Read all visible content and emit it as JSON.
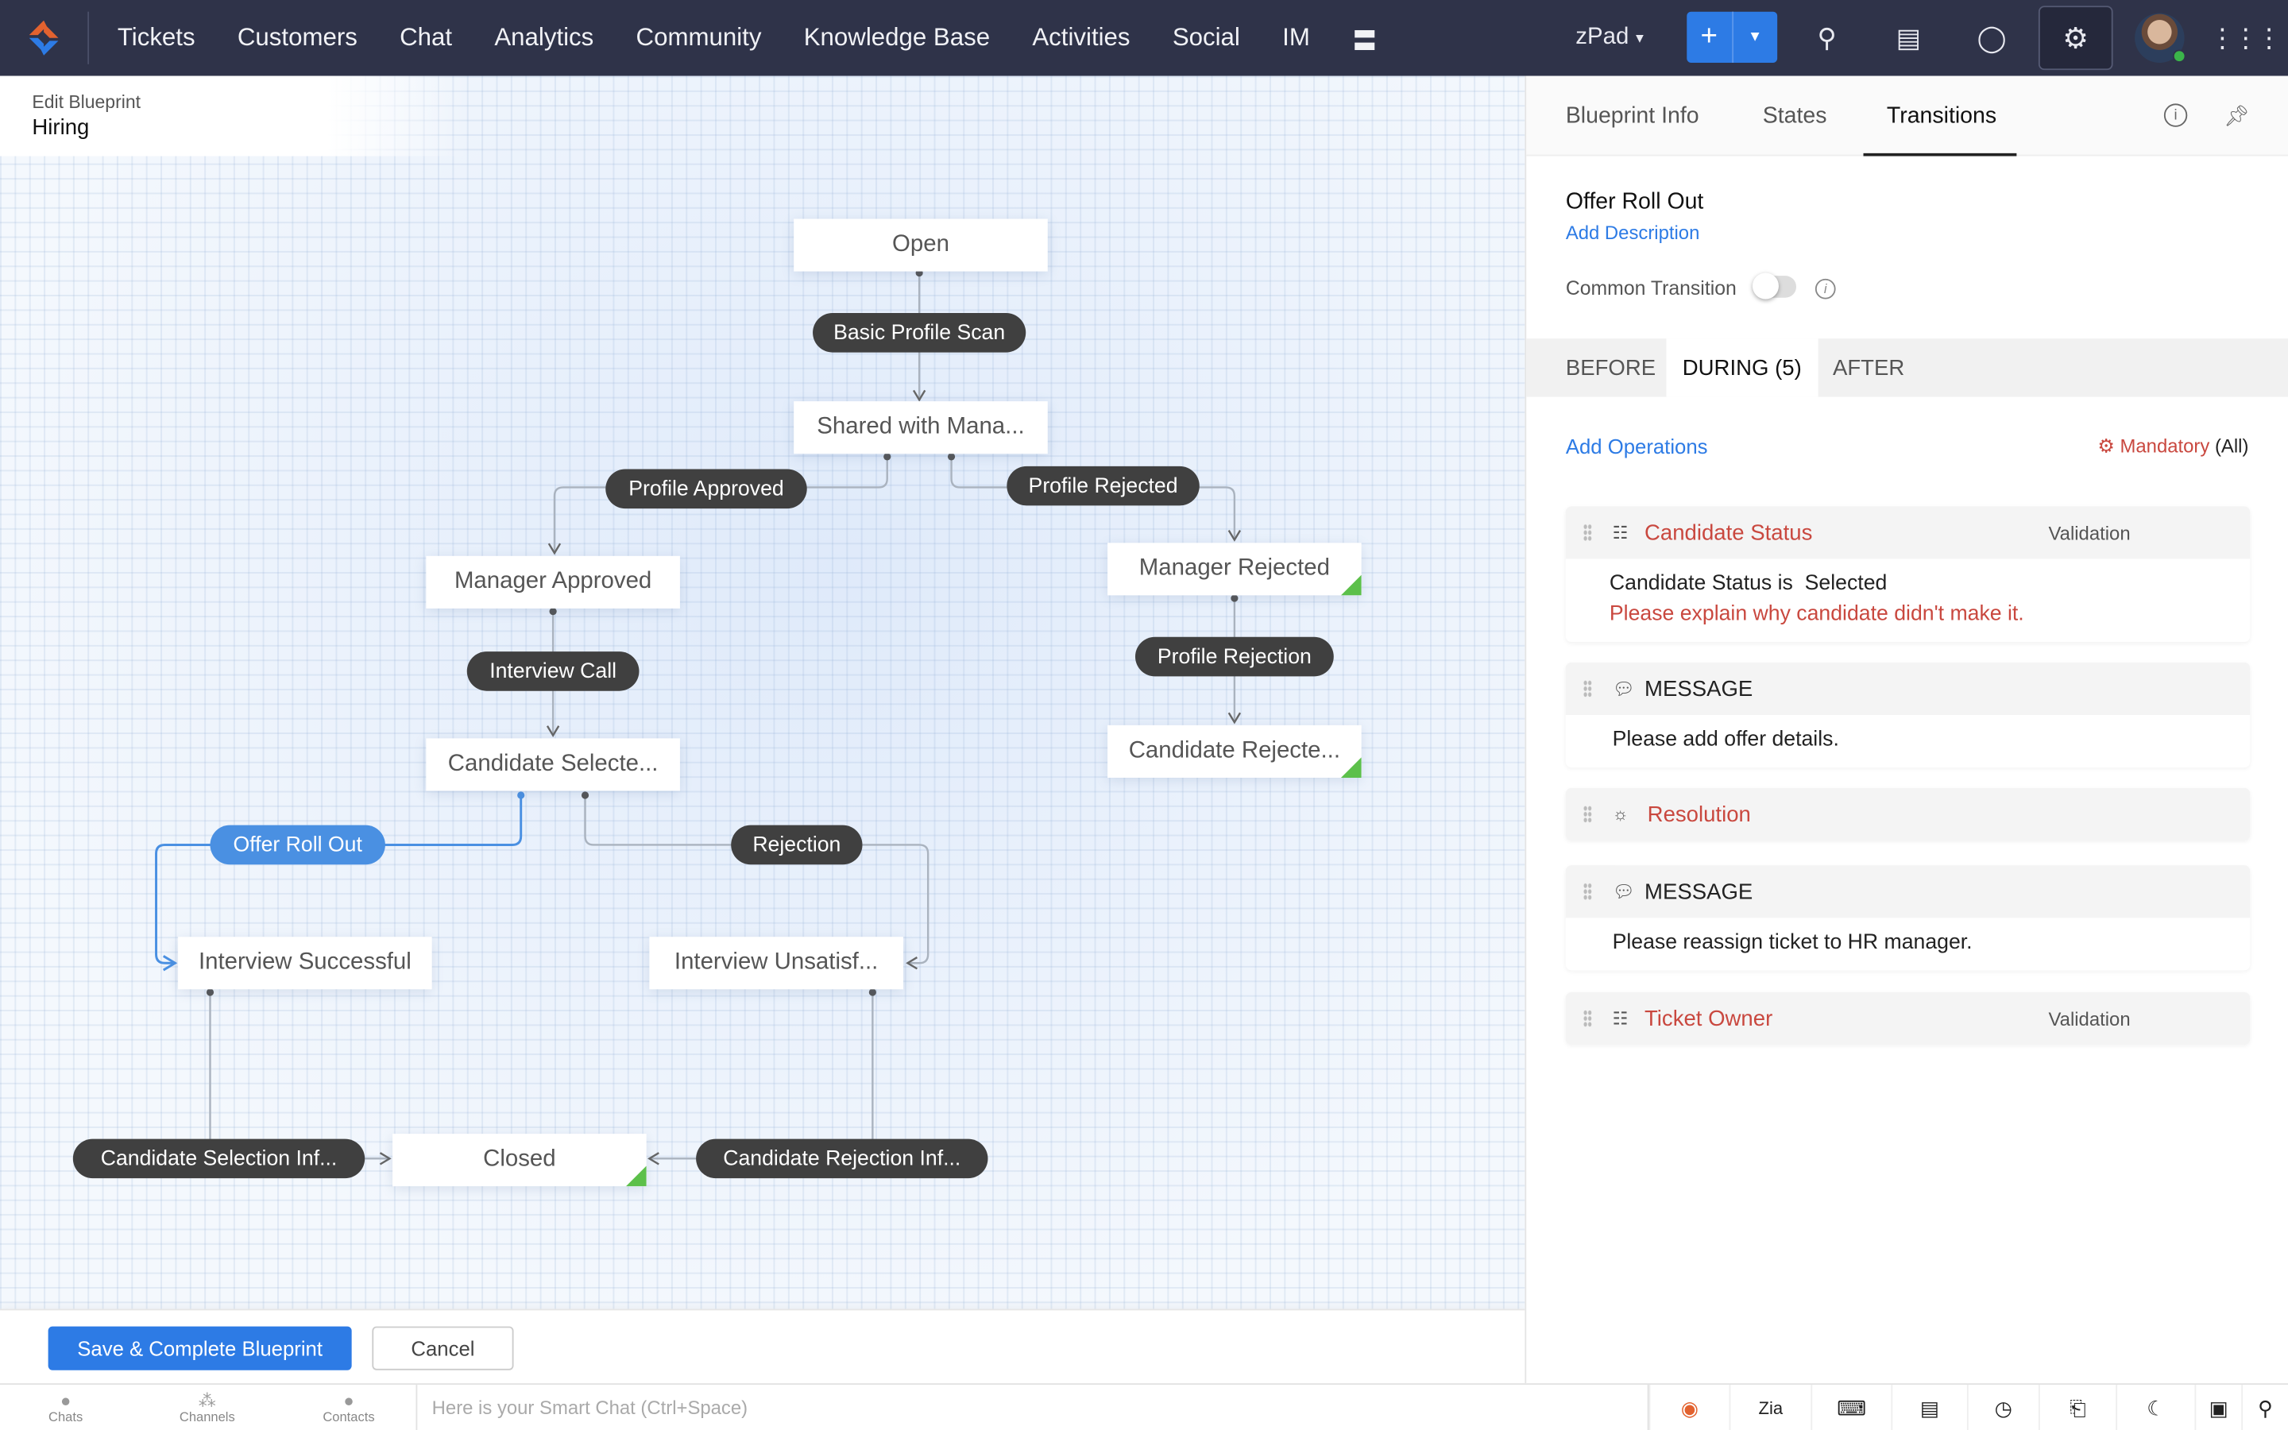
{
  "topbar": {
    "nav": [
      "Tickets",
      "Customers",
      "Chat",
      "Analytics",
      "Community",
      "Knowledge Base",
      "Activities",
      "Social",
      "IM"
    ],
    "more_icon": "hamburger-icon",
    "portal": "zPad",
    "brand_color": "#2f3349",
    "accent": "#2d7be5"
  },
  "breadcrumb": {
    "section": "Edit Blueprint",
    "title": "Hiring"
  },
  "diagram": {
    "states": {
      "open": "Open",
      "shared": "Shared with Mana...",
      "manager_approved": "Manager Approved",
      "manager_rejected": "Manager Rejected",
      "candidate_selected": "Candidate Selecte...",
      "candidate_rejected": "Candidate Rejecte...",
      "interview_successful": "Interview Successful",
      "interview_unsatisfied": "Interview Unsatisf...",
      "closed": "Closed"
    },
    "transitions": {
      "basic_profile_scan": "Basic Profile Scan",
      "profile_approved": "Profile Approved",
      "profile_rejected": "Profile Rejected",
      "interview_call": "Interview Call",
      "profile_rejection": "Profile Rejection",
      "offer_roll_out": "Offer Roll Out",
      "rejection": "Rejection",
      "candidate_selection_inf": "Candidate Selection Inf...",
      "candidate_rejection_inf": "Candidate Rejection Inf..."
    },
    "selected_transition": "Offer Roll Out"
  },
  "footer": {
    "save": "Save & Complete Blueprint",
    "cancel": "Cancel"
  },
  "panel": {
    "tabs": [
      "Blueprint Info",
      "States",
      "Transitions"
    ],
    "active_tab": "Transitions",
    "title": "Offer Roll Out",
    "add_description": "Add Description",
    "common_transition": "Common Transition",
    "common_transition_on": false,
    "stage_tabs": [
      "BEFORE",
      "DURING (5)",
      "AFTER"
    ],
    "active_stage": "DURING (5)",
    "add_operations": "Add Operations",
    "mandatory": "Mandatory",
    "mandatory_scope": "(All)",
    "operations": [
      {
        "icon": "field-list-icon",
        "name": "Candidate Status",
        "tag": "Validation",
        "lines": [
          "Candidate Status is  Selected",
          "Please explain why candidate didn't make it."
        ]
      },
      {
        "icon": "message-icon",
        "name": "MESSAGE",
        "body": "Please add offer details."
      },
      {
        "icon": "bulb-icon",
        "name": "Resolution"
      },
      {
        "icon": "message-icon",
        "name": "MESSAGE",
        "body": "Please reassign ticket to HR manager."
      },
      {
        "icon": "field-list-icon",
        "name": "Ticket Owner",
        "tag": "Validation"
      }
    ]
  },
  "bottombar": {
    "chats": "Chats",
    "channels": "Channels",
    "contacts": "Contacts",
    "smart_chat_placeholder": "Here is your Smart Chat (Ctrl+Space)"
  }
}
